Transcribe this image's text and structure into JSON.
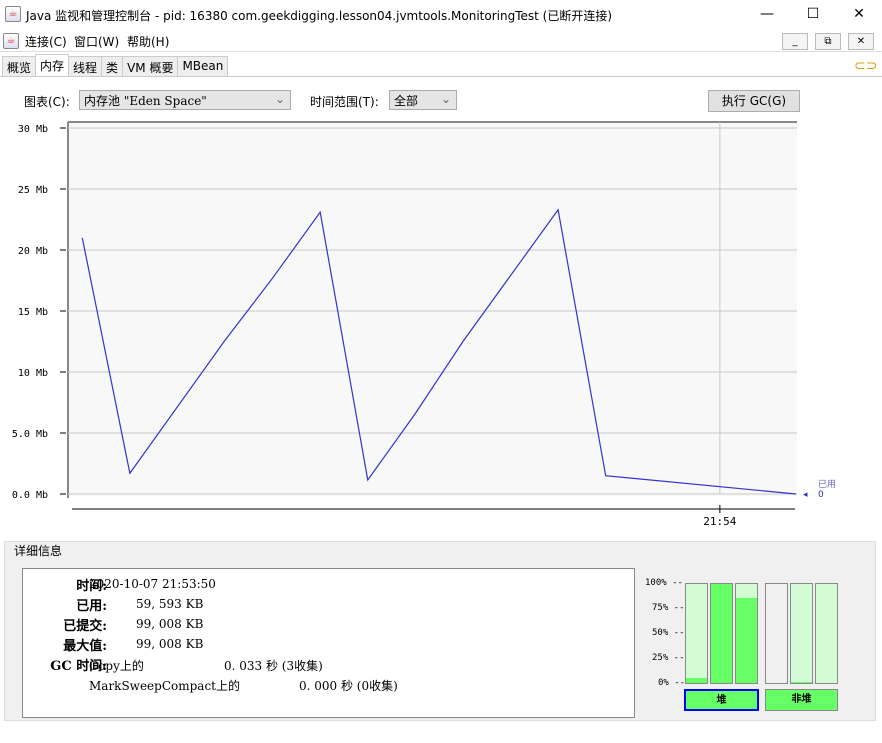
{
  "window": {
    "title": "Java 监视和管理控制台 - pid: 16380 com.geekdigging.lesson04.jvmtools.MonitoringTest (已断开连接)",
    "minimize": "—",
    "maximize": "☐",
    "close": "✕"
  },
  "menu": [
    "连接(C)",
    "窗口(W)",
    "帮助(H)"
  ],
  "mdi": [
    "_",
    "⧉",
    "✕"
  ],
  "tabs": [
    "概览",
    "内存",
    "线程",
    "类",
    "VM 概要",
    "MBean"
  ],
  "controls": {
    "chart_label": "图表(C):",
    "chart_value": "内存池 \"Eden Space\"",
    "range_label": "时间范围(T):",
    "range_value": "全部",
    "gc_button": "执行 GC(G)"
  },
  "chart_data": {
    "type": "line",
    "title": "",
    "xlabel": "",
    "ylabel": "",
    "yunit": "Mb",
    "ylim": [
      0,
      30
    ],
    "yticks": [
      "0.0 Mb",
      "5.0 Mb",
      "10 Mb",
      "15 Mb",
      "20 Mb",
      "25 Mb",
      "30 Mb"
    ],
    "ytick_values": [
      0,
      5,
      10,
      15,
      20,
      25,
      30
    ],
    "xlim": [
      -0.3,
      15
    ],
    "xtick_labels": [
      "21:54"
    ],
    "xtick_values": [
      13.4
    ],
    "grid": true,
    "series": [
      {
        "name": "已用",
        "color": "#3333cc",
        "x": [
          0,
          1,
          3,
          4,
          5,
          6,
          7,
          8,
          10,
          11,
          15
        ],
        "y": [
          21.0,
          1.7,
          12.6,
          17.7,
          23.1,
          1.15,
          6.6,
          12.5,
          23.3,
          1.5,
          0
        ]
      }
    ],
    "legend": {
      "label": "已用",
      "value": "0",
      "position": "right"
    }
  },
  "details": {
    "title": "详细信息",
    "time_label": "时间:",
    "time": "2020-10-07 21:53:50",
    "used_label": "已用:",
    "used": "59, 593 KB",
    "committed_label": "已提交:",
    "committed": "99, 008 KB",
    "max_label": "最大值:",
    "max": "99, 008 KB",
    "gc_label": "GC 时间:",
    "gc": [
      {
        "name": "Copy上的",
        "time": "0. 033  秒 (3收集)"
      },
      {
        "name": "MarkSweepCompact上的",
        "time": "0. 000  秒 (0收集)"
      }
    ]
  },
  "usage": {
    "pct_labels": [
      "100% --",
      "75% --",
      "50% --",
      "25% --",
      "0% --"
    ],
    "heap_label": "堆",
    "nonheap_label": "非堆",
    "heap_bars": [
      0.05,
      1.0,
      0.86
    ],
    "nonheap_bars": [
      0,
      0.01,
      0
    ],
    "nonheap_bg": [
      "#f0f0f0",
      "#d4fcd4",
      "#d4fcd4"
    ]
  }
}
